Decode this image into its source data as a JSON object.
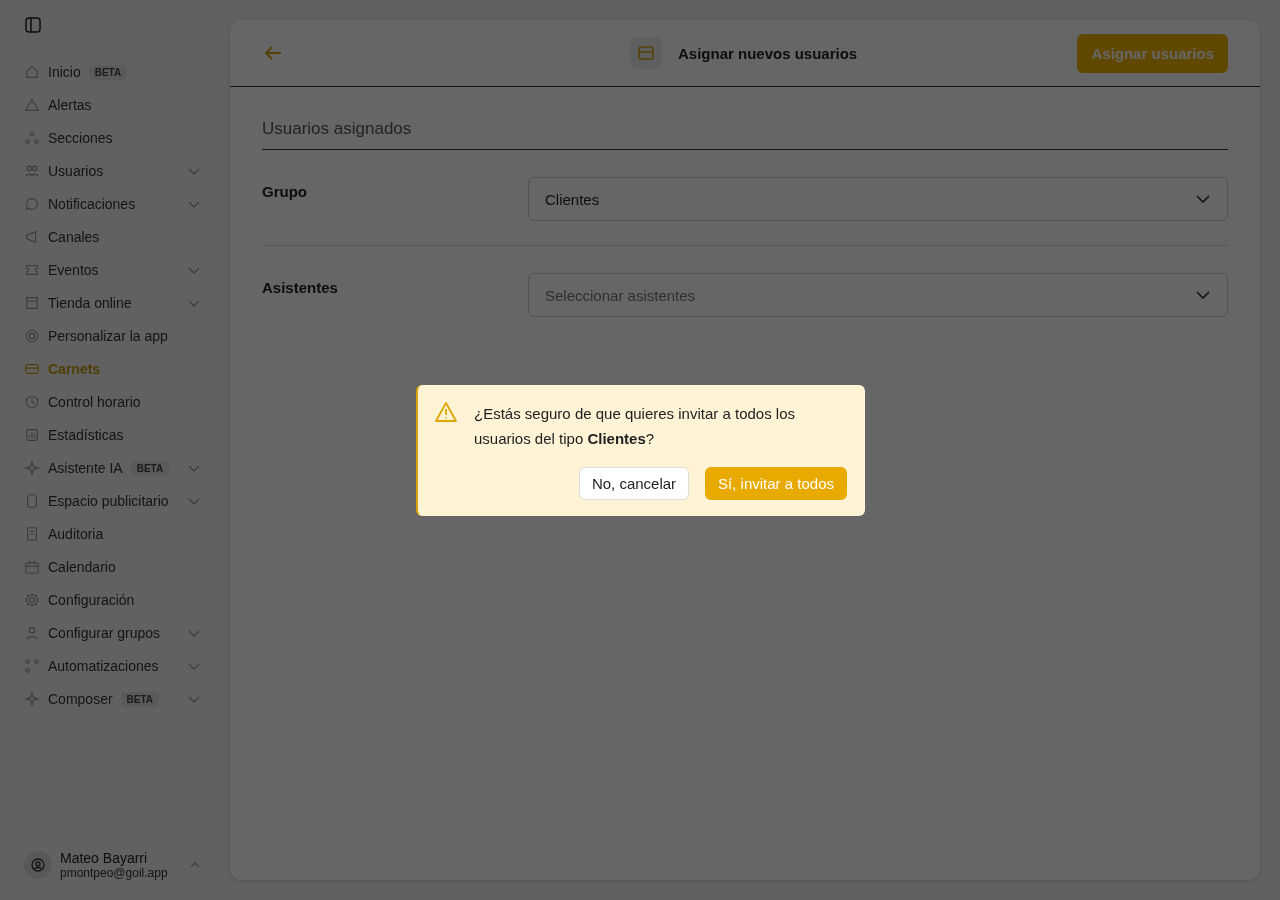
{
  "sidebar": {
    "items": [
      {
        "label": "Inicio",
        "badge": "BETA",
        "expandable": false,
        "selected": false
      },
      {
        "label": "Alertas",
        "expandable": false,
        "selected": false
      },
      {
        "label": "Secciones",
        "expandable": false,
        "selected": false
      },
      {
        "label": "Usuarios",
        "expandable": true,
        "selected": false
      },
      {
        "label": "Notificaciones",
        "expandable": true,
        "selected": false
      },
      {
        "label": "Canales",
        "expandable": false,
        "selected": false
      },
      {
        "label": "Eventos",
        "expandable": true,
        "selected": false
      },
      {
        "label": "Tienda online",
        "expandable": true,
        "selected": false
      },
      {
        "label": "Personalizar la app",
        "expandable": false,
        "selected": false
      },
      {
        "label": "Carnets",
        "expandable": false,
        "selected": true
      },
      {
        "label": "Control horario",
        "expandable": false,
        "selected": false
      },
      {
        "label": "Estadísticas",
        "expandable": false,
        "selected": false
      },
      {
        "label": "Asistente IA",
        "badge": "BETA",
        "expandable": true,
        "selected": false
      },
      {
        "label": "Espacio publicitario",
        "expandable": true,
        "selected": false
      },
      {
        "label": "Auditoria",
        "expandable": false,
        "selected": false
      },
      {
        "label": "Calendario",
        "expandable": false,
        "selected": false
      },
      {
        "label": "Configuración",
        "expandable": false,
        "selected": false
      },
      {
        "label": "Configurar grupos",
        "expandable": true,
        "selected": false
      },
      {
        "label": "Automatizaciones",
        "expandable": true,
        "selected": false
      },
      {
        "label": "Composer",
        "badge": "BETA",
        "expandable": true,
        "selected": false
      }
    ],
    "user": {
      "name": "Mateo Bayarri",
      "email": "pmontpeo@goil.app"
    }
  },
  "header": {
    "title": "Asignar nuevos usuarios",
    "action": "Asignar usuarios"
  },
  "section_title": "Usuarios asignados",
  "fields": [
    {
      "label": "Grupo",
      "value": "Clientes"
    },
    {
      "label": "Asistentes",
      "placeholder": "Seleccionar asistentes"
    }
  ],
  "dialog": {
    "message": "¿Estás seguro de que quieres invitar a todos los usuarios del tipo **Clientes**?",
    "cancel": "No, cancelar",
    "confirm": "Sí, invitar a todos"
  }
}
